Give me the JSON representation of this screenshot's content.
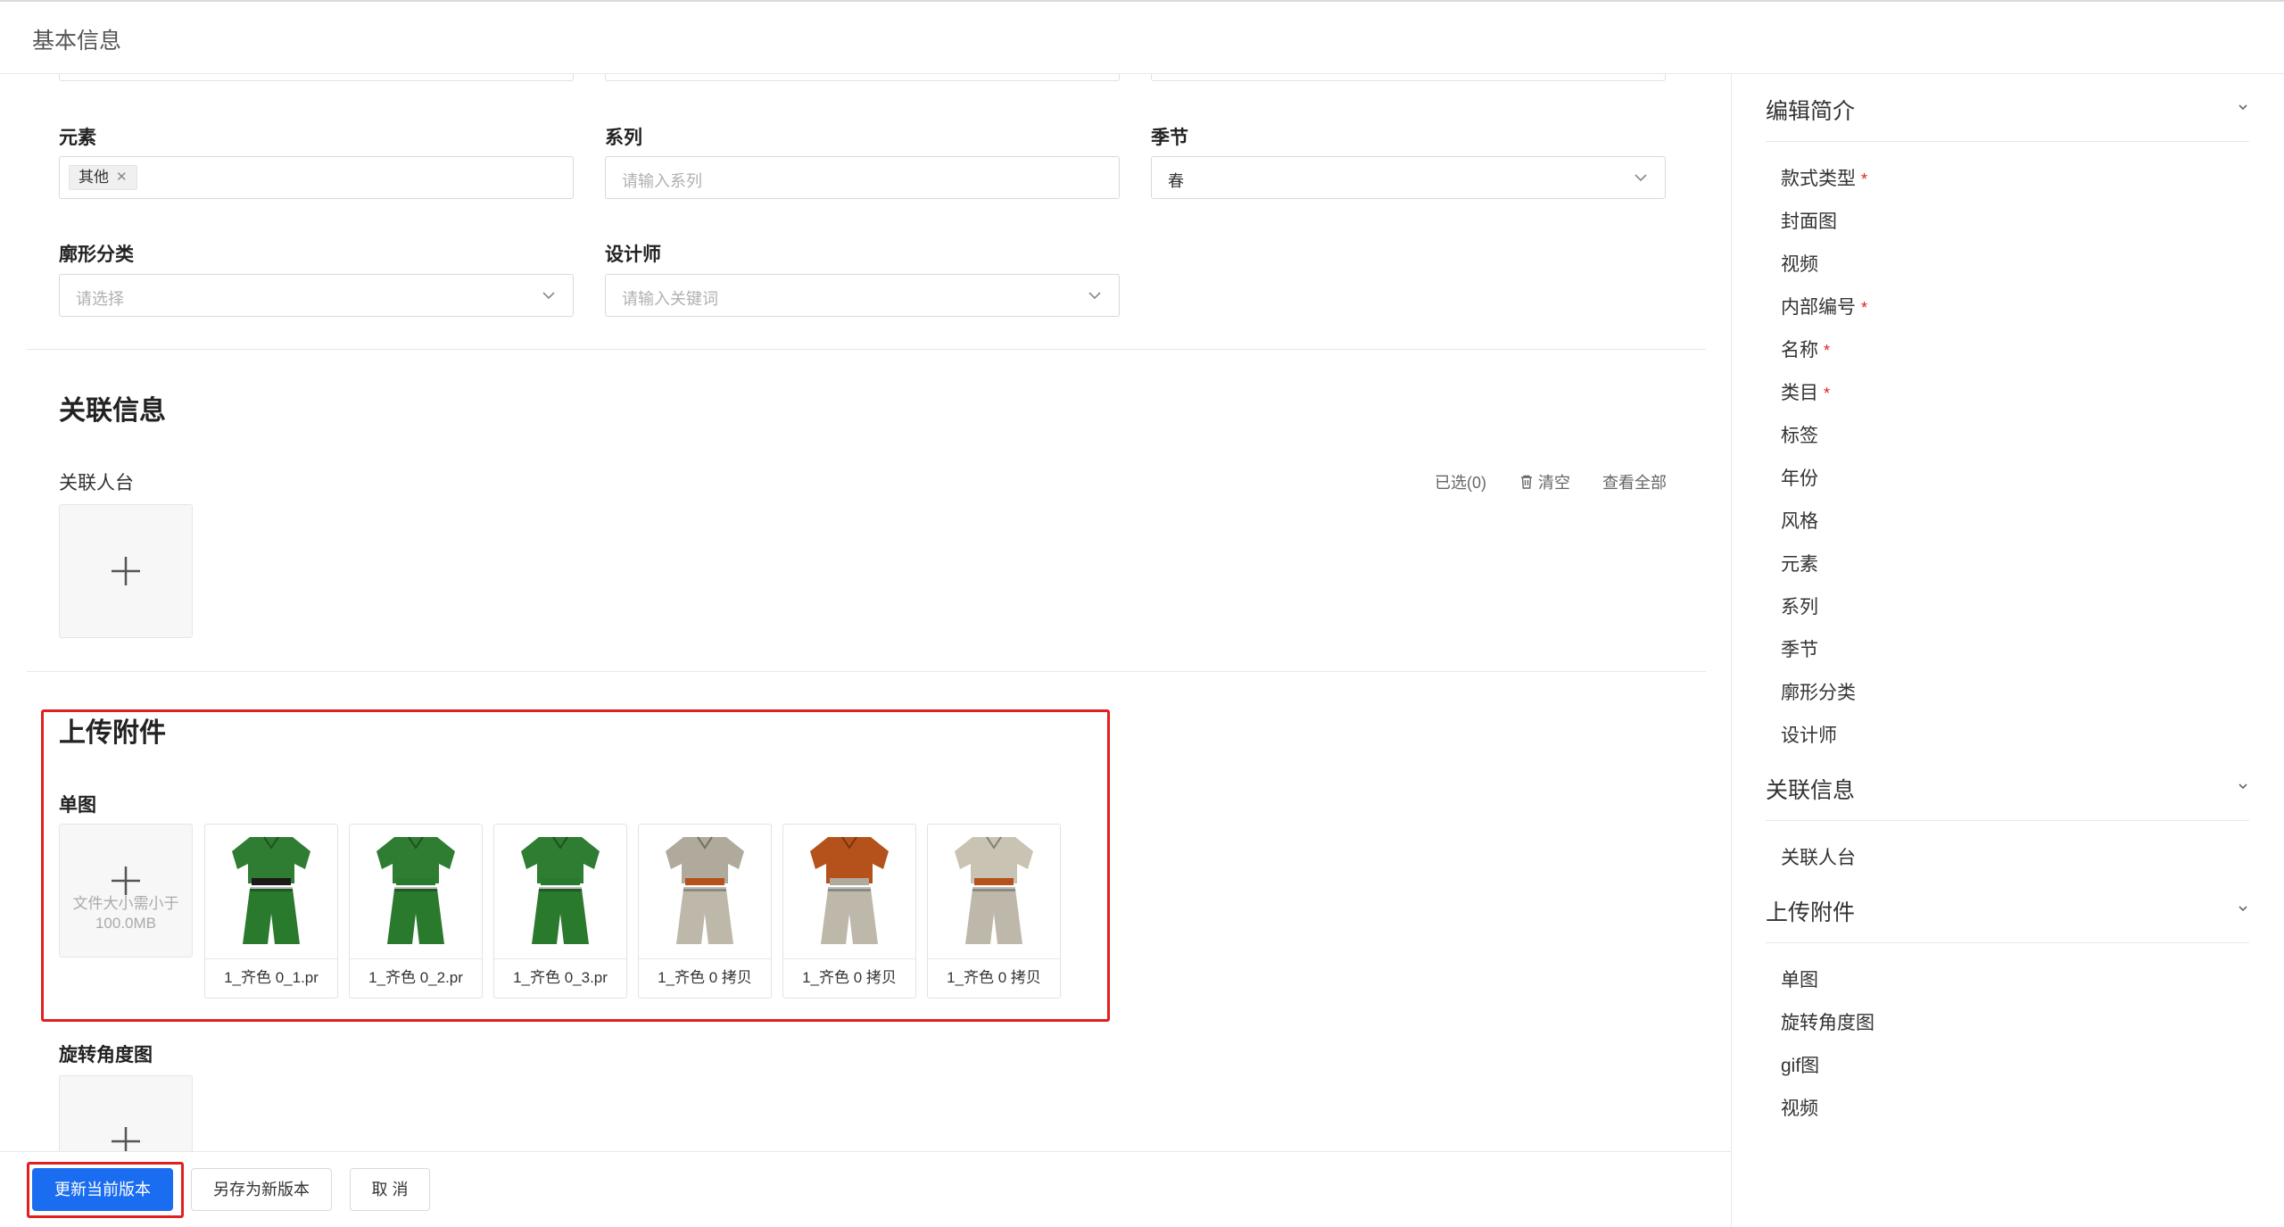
{
  "header": {
    "title": "基本信息"
  },
  "form": {
    "element": {
      "label": "元素",
      "tag": "其他"
    },
    "series": {
      "label": "系列",
      "placeholder": "请输入系列"
    },
    "season": {
      "label": "季节",
      "value": "春"
    },
    "silhouette": {
      "label": "廓形分类",
      "placeholder": "请选择"
    },
    "designer": {
      "label": "设计师",
      "placeholder": "请输入关键词"
    }
  },
  "related": {
    "title": "关联信息",
    "mannequin_label": "关联人台",
    "selected": "已选(0)",
    "clear": "清空",
    "view_all": "查看全部"
  },
  "attachments": {
    "title": "上传附件",
    "single_label": "单图",
    "upload_hint_line1": "文件大小需小于",
    "upload_hint_line2": "100.0MB",
    "files": [
      {
        "name": "1_齐色 0_1.pr",
        "colors": {
          "top": "#2e7d32",
          "bottom": "#2a7a2e",
          "accent": "#1b1b1b"
        }
      },
      {
        "name": "1_齐色 0_2.pr",
        "colors": {
          "top": "#2e7d32",
          "bottom": "#2a7a2e",
          "accent": "#2a7a2e"
        }
      },
      {
        "name": "1_齐色 0_3.pr",
        "colors": {
          "top": "#2e7d32",
          "bottom": "#2a7a2e",
          "accent": "#2a7a2e"
        }
      },
      {
        "name": "1_齐色 0 拷贝",
        "colors": {
          "top": "#b0aa9c",
          "bottom": "#bdb8aa",
          "accent": "#b5521c"
        }
      },
      {
        "name": "1_齐色 0 拷贝",
        "colors": {
          "top": "#b5521c",
          "bottom": "#bdb8aa",
          "accent": "#b0aa9c"
        }
      },
      {
        "name": "1_齐色 0 拷贝",
        "colors": {
          "top": "#c9c3b4",
          "bottom": "#bdb8aa",
          "accent": "#b5521c"
        }
      }
    ],
    "rotation_label": "旋转角度图"
  },
  "footer": {
    "update_label": "更新当前版本",
    "save_new_label": "另存为新版本",
    "cancel_label": "取 消"
  },
  "sidebar": {
    "groups": [
      {
        "title": "编辑简介",
        "items": [
          {
            "label": "款式类型",
            "required": "*"
          },
          {
            "label": "封面图"
          },
          {
            "label": "视频"
          },
          {
            "label": "内部编号",
            "required": "*"
          },
          {
            "label": "名称",
            "required": "*"
          },
          {
            "label": "类目",
            "required": "*"
          },
          {
            "label": "标签"
          },
          {
            "label": "年份"
          },
          {
            "label": "风格"
          },
          {
            "label": "元素"
          },
          {
            "label": "系列"
          },
          {
            "label": "季节"
          },
          {
            "label": "廓形分类"
          },
          {
            "label": "设计师"
          }
        ]
      },
      {
        "title": "关联信息",
        "items": [
          {
            "label": "关联人台"
          }
        ]
      },
      {
        "title": "上传附件",
        "items": [
          {
            "label": "单图"
          },
          {
            "label": "旋转角度图"
          },
          {
            "label": "gif图"
          },
          {
            "label": "视频"
          }
        ]
      }
    ]
  },
  "colors": {
    "primary": "#1a6cf0",
    "highlight": "#e02020",
    "required": "#e02020"
  }
}
